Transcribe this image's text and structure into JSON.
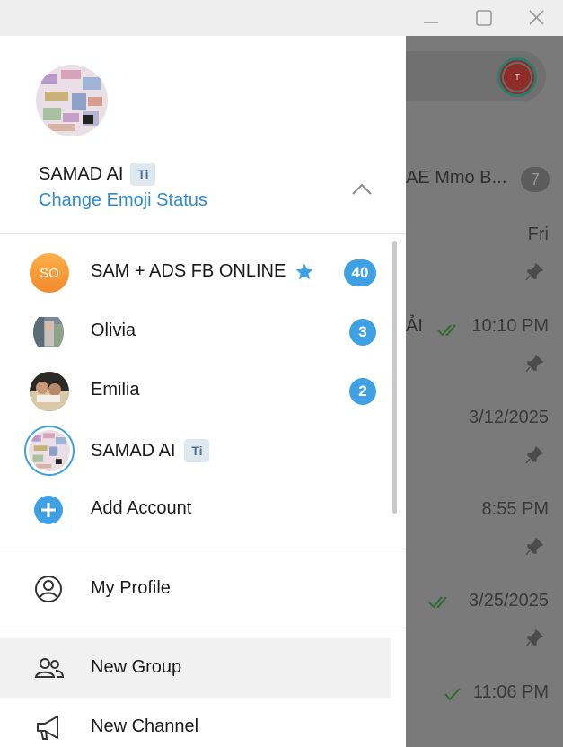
{
  "window": {
    "controls": [
      "minimize-icon",
      "maximize-icon",
      "close-icon"
    ]
  },
  "profile": {
    "name": "SAMAD AI",
    "emoji_tag": "Ti",
    "status_link": "Change Emoji Status"
  },
  "accounts": [
    {
      "name": "SAM + ADS FB ONLINE",
      "avatar_initials": "SO",
      "badge": "40",
      "starred": true
    },
    {
      "name": "Olivia",
      "badge": "3"
    },
    {
      "name": "Emilia",
      "badge": "2"
    },
    {
      "name": "SAMAD AI",
      "emoji_tag": "Ti",
      "badge": null
    },
    {
      "name": "Add Account"
    }
  ],
  "menu": {
    "my_profile": "My Profile",
    "new_group": "New Group",
    "new_channel": "New Channel"
  },
  "background_chats": {
    "avatar_initial": "T",
    "row1_text": "AE Mmo B...",
    "row1_badge": "7",
    "row1_time": "Fri",
    "row2_text": "ẢI",
    "row2_time": "10:10 PM",
    "row3_time": "3/12/2025",
    "row4_time": "8:55 PM",
    "row5_time": "3/25/2025",
    "row6_time": "11:06 PM"
  },
  "colors": {
    "accent": "#3fa0e3",
    "link": "#2e8bd0",
    "overlay": "#7a7a7a"
  }
}
